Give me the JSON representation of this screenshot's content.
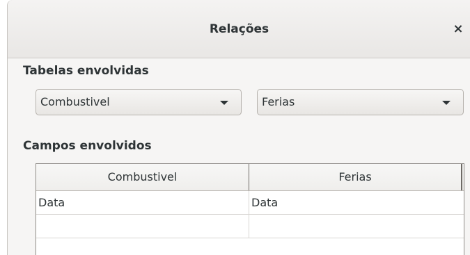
{
  "dialog": {
    "title": "Relações",
    "close_glyph": "×"
  },
  "tables_section": {
    "label": "Tabelas envolvidas",
    "left_table": "Combustivel",
    "right_table": "Ferias"
  },
  "fields_section": {
    "label": "Campos envolvidos",
    "columns": [
      "Combustivel",
      "Ferias"
    ],
    "rows": [
      [
        "Data",
        "Data"
      ],
      [
        "",
        ""
      ]
    ]
  }
}
